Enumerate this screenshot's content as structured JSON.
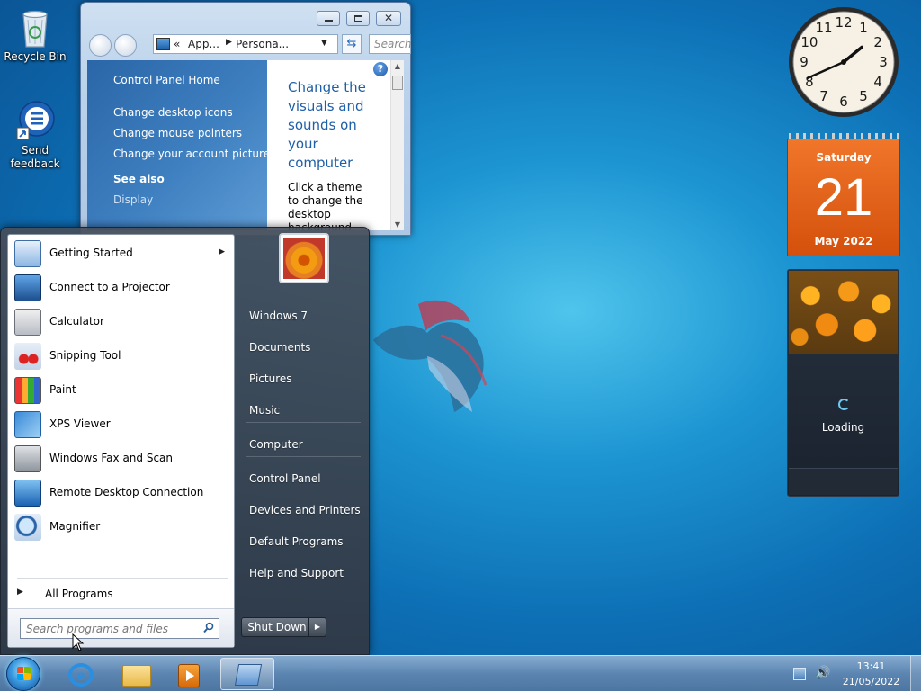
{
  "desktop": {
    "icons": [
      {
        "label": "Recycle Bin"
      },
      {
        "label": "Send feedback"
      }
    ]
  },
  "window": {
    "address": {
      "prefix": "«",
      "crumb1": "App...",
      "crumb2": "Persona..."
    },
    "search_placeholder": "Search",
    "left_links": {
      "home": "Control Panel Home",
      "desktop_icons": "Change desktop icons",
      "mouse_pointers": "Change mouse pointers",
      "account_picture": "Change your account picture",
      "see_also": "See also",
      "display": "Display"
    },
    "heading": "Change the visuals and sounds on your computer",
    "body": "Click a theme to change the desktop background,"
  },
  "start_menu": {
    "programs": [
      {
        "label": "Getting Started",
        "icon": "getting-started-icon",
        "has_submenu": true
      },
      {
        "label": "Connect to a Projector",
        "icon": "projector-icon"
      },
      {
        "label": "Calculator",
        "icon": "calculator-icon"
      },
      {
        "label": "Snipping Tool",
        "icon": "scissors-icon"
      },
      {
        "label": "Paint",
        "icon": "paint-icon"
      },
      {
        "label": "XPS Viewer",
        "icon": "xps-viewer-icon"
      },
      {
        "label": "Windows Fax and Scan",
        "icon": "fax-icon"
      },
      {
        "label": "Remote Desktop Connection",
        "icon": "remote-desktop-icon"
      },
      {
        "label": "Magnifier",
        "icon": "magnifier-icon"
      }
    ],
    "all_programs": "All Programs",
    "search_placeholder": "Search programs and files",
    "places": [
      "Windows 7",
      "Documents",
      "Pictures",
      "Music",
      "Computer",
      "Control Panel",
      "Devices and Printers",
      "Default Programs",
      "Help and Support"
    ],
    "shutdown": "Shut Down"
  },
  "gadgets": {
    "clock": {
      "hour": 1,
      "minute": 41,
      "numbers": [
        "12",
        "1",
        "2",
        "3",
        "4",
        "5",
        "6",
        "7",
        "8",
        "9",
        "10",
        "11"
      ]
    },
    "calendar": {
      "weekday": "Saturday",
      "day": "21",
      "month_year": "May 2022"
    },
    "slideshow": {
      "status": "Loading"
    }
  },
  "taskbar": {
    "time": "13:41",
    "date": "21/05/2022"
  },
  "colors": {
    "calendar_orange": "#e2580e",
    "link_blue": "#1f5fa8",
    "start_menu_dark": "#3a4350"
  }
}
